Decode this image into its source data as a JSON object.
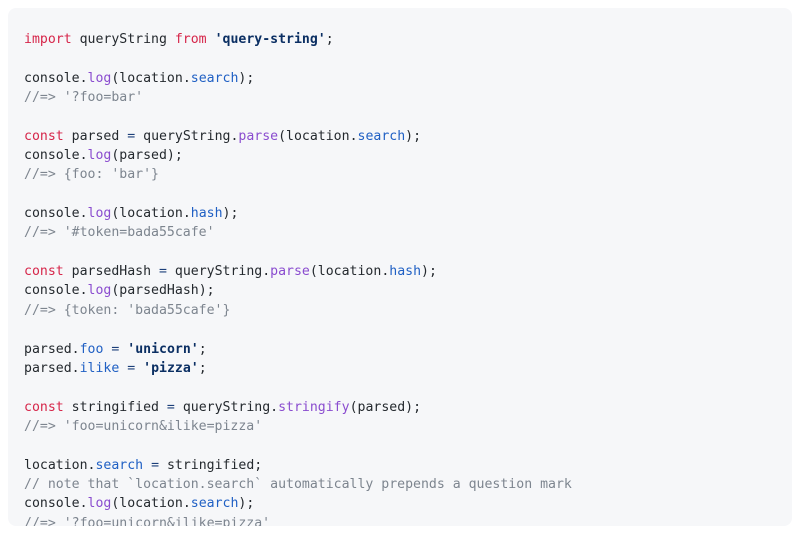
{
  "panel": {
    "background": "#f6f7f9",
    "language": "javascript"
  },
  "theme": {
    "keyword": "#d6264a",
    "function": "#8a4ccf",
    "property": "#2060c4",
    "string": "#0b2f63",
    "comment": "#7d858f",
    "operator": "#1c3f7a",
    "plain": "#24292e",
    "page_background": "#ffffff"
  },
  "code": {
    "lines": [
      [
        {
          "t": "import",
          "c": "kw"
        },
        {
          "t": " queryString ",
          "c": "plain"
        },
        {
          "t": "from",
          "c": "kw"
        },
        {
          "t": " ",
          "c": "plain"
        },
        {
          "t": "'query-string'",
          "c": "str"
        },
        {
          "t": ";",
          "c": "punc"
        }
      ],
      [],
      [
        {
          "t": "console.",
          "c": "plain"
        },
        {
          "t": "log",
          "c": "fn"
        },
        {
          "t": "(location.",
          "c": "plain"
        },
        {
          "t": "search",
          "c": "prop"
        },
        {
          "t": ");",
          "c": "punc"
        }
      ],
      [
        {
          "t": "//=> '?foo=bar'",
          "c": "com"
        }
      ],
      [],
      [
        {
          "t": "const",
          "c": "kw"
        },
        {
          "t": " parsed ",
          "c": "plain"
        },
        {
          "t": "=",
          "c": "op"
        },
        {
          "t": " queryString.",
          "c": "plain"
        },
        {
          "t": "parse",
          "c": "fn"
        },
        {
          "t": "(location.",
          "c": "plain"
        },
        {
          "t": "search",
          "c": "prop"
        },
        {
          "t": ");",
          "c": "punc"
        }
      ],
      [
        {
          "t": "console.",
          "c": "plain"
        },
        {
          "t": "log",
          "c": "fn"
        },
        {
          "t": "(parsed);",
          "c": "plain"
        }
      ],
      [
        {
          "t": "//=> {foo: 'bar'}",
          "c": "com"
        }
      ],
      [],
      [
        {
          "t": "console.",
          "c": "plain"
        },
        {
          "t": "log",
          "c": "fn"
        },
        {
          "t": "(location.",
          "c": "plain"
        },
        {
          "t": "hash",
          "c": "prop"
        },
        {
          "t": ");",
          "c": "punc"
        }
      ],
      [
        {
          "t": "//=> '#token=bada55cafe'",
          "c": "com"
        }
      ],
      [],
      [
        {
          "t": "const",
          "c": "kw"
        },
        {
          "t": " parsedHash ",
          "c": "plain"
        },
        {
          "t": "=",
          "c": "op"
        },
        {
          "t": " queryString.",
          "c": "plain"
        },
        {
          "t": "parse",
          "c": "fn"
        },
        {
          "t": "(location.",
          "c": "plain"
        },
        {
          "t": "hash",
          "c": "prop"
        },
        {
          "t": ");",
          "c": "punc"
        }
      ],
      [
        {
          "t": "console.",
          "c": "plain"
        },
        {
          "t": "log",
          "c": "fn"
        },
        {
          "t": "(parsedHash);",
          "c": "plain"
        }
      ],
      [
        {
          "t": "//=> {token: 'bada55cafe'}",
          "c": "com"
        }
      ],
      [],
      [
        {
          "t": "parsed.",
          "c": "plain"
        },
        {
          "t": "foo",
          "c": "prop"
        },
        {
          "t": " ",
          "c": "plain"
        },
        {
          "t": "=",
          "c": "op"
        },
        {
          "t": " ",
          "c": "plain"
        },
        {
          "t": "'unicorn'",
          "c": "str"
        },
        {
          "t": ";",
          "c": "punc"
        }
      ],
      [
        {
          "t": "parsed.",
          "c": "plain"
        },
        {
          "t": "ilike",
          "c": "prop"
        },
        {
          "t": " ",
          "c": "plain"
        },
        {
          "t": "=",
          "c": "op"
        },
        {
          "t": " ",
          "c": "plain"
        },
        {
          "t": "'pizza'",
          "c": "str"
        },
        {
          "t": ";",
          "c": "punc"
        }
      ],
      [],
      [
        {
          "t": "const",
          "c": "kw"
        },
        {
          "t": " stringified ",
          "c": "plain"
        },
        {
          "t": "=",
          "c": "op"
        },
        {
          "t": " queryString.",
          "c": "plain"
        },
        {
          "t": "stringify",
          "c": "fn"
        },
        {
          "t": "(parsed);",
          "c": "plain"
        }
      ],
      [
        {
          "t": "//=> 'foo=unicorn&ilike=pizza'",
          "c": "com"
        }
      ],
      [],
      [
        {
          "t": "location.",
          "c": "plain"
        },
        {
          "t": "search",
          "c": "prop"
        },
        {
          "t": " ",
          "c": "plain"
        },
        {
          "t": "=",
          "c": "op"
        },
        {
          "t": " stringified;",
          "c": "plain"
        }
      ],
      [
        {
          "t": "// note that `location.search` automatically prepends a question mark",
          "c": "com"
        }
      ],
      [
        {
          "t": "console.",
          "c": "plain"
        },
        {
          "t": "log",
          "c": "fn"
        },
        {
          "t": "(location.",
          "c": "plain"
        },
        {
          "t": "search",
          "c": "prop"
        },
        {
          "t": ");",
          "c": "punc"
        }
      ],
      [
        {
          "t": "//=> '?foo=unicorn&ilike=pizza'",
          "c": "com"
        }
      ]
    ]
  }
}
